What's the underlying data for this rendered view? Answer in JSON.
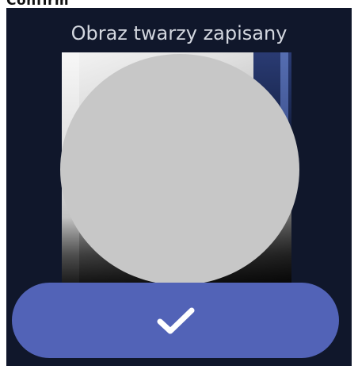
{
  "header": {
    "cut_text": "Confirm"
  },
  "screen": {
    "title": "Obraz twarzy zapisany"
  },
  "photo": {
    "mask_color": "#c7c7c7"
  },
  "confirm_button": {
    "icon": "check-icon",
    "color": "#5263b7"
  },
  "colors": {
    "background": "#10172b",
    "title_text": "#d3d7df"
  }
}
